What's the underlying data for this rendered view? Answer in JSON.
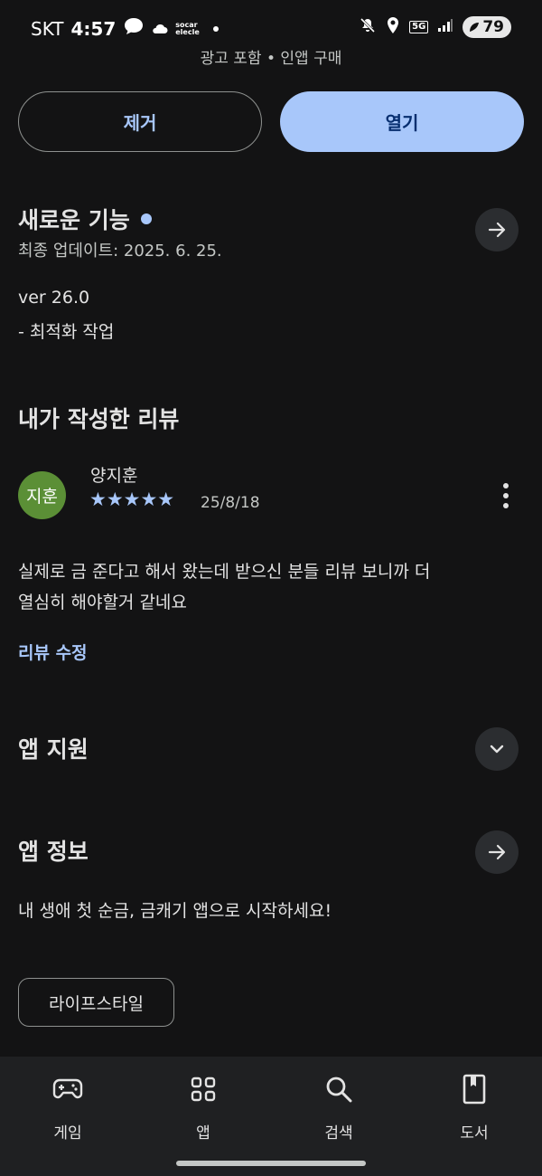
{
  "status_bar": {
    "carrier": "SKT",
    "time": "4:57",
    "socar_label": "socar elecle",
    "network": "5G",
    "battery": "79"
  },
  "app_meta": "광고 포함 • 인앱 구매",
  "actions": {
    "remove_label": "제거",
    "open_label": "열기"
  },
  "whats_new": {
    "title": "새로운 기능",
    "last_updated": "최종 업데이트: 2025. 6. 25.",
    "version": "ver 26.0",
    "notes": "- 최적화 작업"
  },
  "my_review": {
    "title": "내가 작성한 리뷰",
    "avatar_text": "지훈",
    "author": "양지훈",
    "rating": 5,
    "stars": "★★★★★",
    "date": "25/8/18",
    "body_line1": "실제로 금 준다고 해서 왔는데 받으신 분들 리뷰 보니까 더",
    "body_line2": "열심히 해야할거 같네요",
    "edit_label": "리뷰 수정"
  },
  "app_support": {
    "title": "앱 지원"
  },
  "app_info": {
    "title": "앱 정보",
    "description": "내 생애 첫 순금, 금캐기 앱으로 시작하세요!",
    "category_chip": "라이프스타일"
  },
  "bottom_nav": {
    "items": [
      {
        "label": "게임",
        "icon": "gamepad-icon"
      },
      {
        "label": "앱",
        "icon": "apps-grid-icon"
      },
      {
        "label": "검색",
        "icon": "search-icon"
      },
      {
        "label": "도서",
        "icon": "book-icon"
      }
    ]
  },
  "colors": {
    "background": "#131314",
    "accent": "#a8c7fa",
    "avatar": "#5b8f36"
  }
}
